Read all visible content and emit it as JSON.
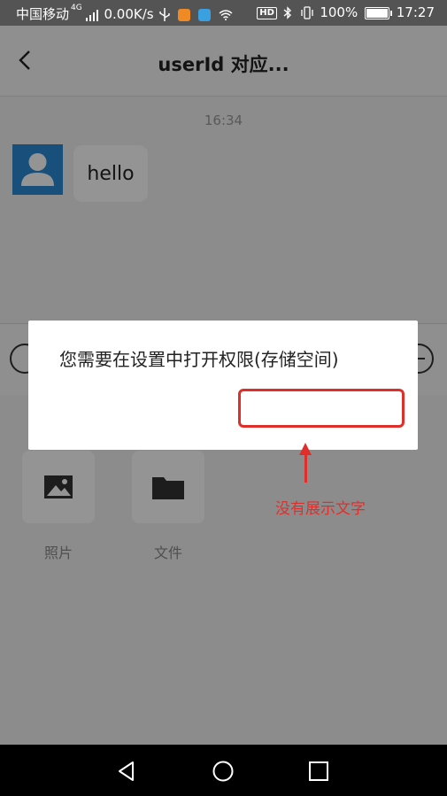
{
  "status_bar": {
    "carrier": "中国移动",
    "network_badge": "4G",
    "speed": "0.00K/s",
    "hd_badge": "HD",
    "battery": "100%",
    "time": "17:27",
    "icons": [
      "signal-icon",
      "usb-icon",
      "app-notification-icon",
      "app-notification-icon",
      "wifi-icon",
      "bluetooth-icon",
      "vibrate-icon",
      "battery-icon"
    ]
  },
  "header": {
    "title": "userId 对应...",
    "back_icon": "chevron-left-icon"
  },
  "chat": {
    "timestamp": "16:34",
    "messages": [
      {
        "text": "hello",
        "avatar": "user-avatar-icon"
      }
    ]
  },
  "panel": {
    "items": [
      {
        "label": "照片",
        "icon": "photo-icon"
      },
      {
        "label": "文件",
        "icon": "folder-icon"
      }
    ]
  },
  "dialog": {
    "message": "您需要在设置中打开权限(存储空间)",
    "button_label": ""
  },
  "annotation": {
    "text": "没有展示文字",
    "color": "#e02f2b"
  },
  "colors": {
    "accent": "#e02f2b",
    "avatar_bg": "#2a8ad4"
  }
}
